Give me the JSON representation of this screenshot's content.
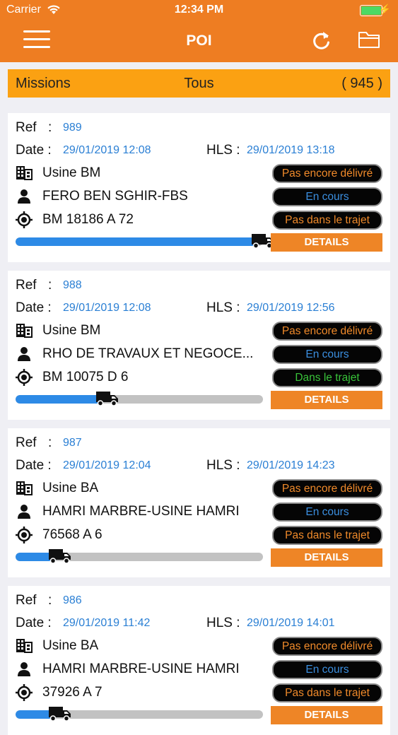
{
  "status_bar": {
    "carrier": "Carrier",
    "time": "12:34 PM"
  },
  "header": {
    "title": "POI"
  },
  "missions_bar": {
    "label": "Missions",
    "filter": "Tous",
    "count": "( 945 )"
  },
  "labels": {
    "ref": "Ref",
    "colon": ":",
    "date": "Date :",
    "hls": "HLS :",
    "details": "DETAILS"
  },
  "colors": {
    "header": "#ee7d22",
    "missions_bar": "#fba112",
    "link_blue": "#2a7fd4",
    "progress": "#2d8ae6",
    "details": "#ee8526"
  },
  "missions": [
    {
      "ref": "989",
      "date": "29/01/2019 12:08",
      "hls": "29/01/2019 13:18",
      "site": "Usine BM",
      "client": "FERO BEN SGHIR-FBS",
      "location": "BM 18186 A 72",
      "status_delivery": "Pas encore délivré",
      "status_progress": "En cours",
      "status_route": "Pas dans le trajet",
      "route_color": "orange",
      "progress": 1.0
    },
    {
      "ref": "988",
      "date": "29/01/2019 12:08",
      "hls": "29/01/2019 12:56",
      "site": "Usine BM",
      "client": "RHO DE TRAVAUX ET NEGOCE...",
      "location": "BM 10075 D 6",
      "status_delivery": "Pas encore délivré",
      "status_progress": "En cours",
      "status_route": "Dans le trajet",
      "route_color": "green",
      "progress": 0.37
    },
    {
      "ref": "987",
      "date": "29/01/2019 12:04",
      "hls": "29/01/2019 14:23",
      "site": "Usine BA",
      "client": "HAMRI MARBRE-USINE HAMRI",
      "location": "76568 A 6",
      "status_delivery": "Pas encore délivré",
      "status_progress": "En cours",
      "status_route": "Pas dans le trajet",
      "route_color": "orange",
      "progress": 0.18
    },
    {
      "ref": "986",
      "date": "29/01/2019 11:42",
      "hls": "29/01/2019 14:01",
      "site": "Usine BA",
      "client": "HAMRI MARBRE-USINE HAMRI",
      "location": "37926 A 7",
      "status_delivery": "Pas encore délivré",
      "status_progress": "En cours",
      "status_route": "Pas dans le trajet",
      "route_color": "orange",
      "progress": 0.18
    }
  ]
}
